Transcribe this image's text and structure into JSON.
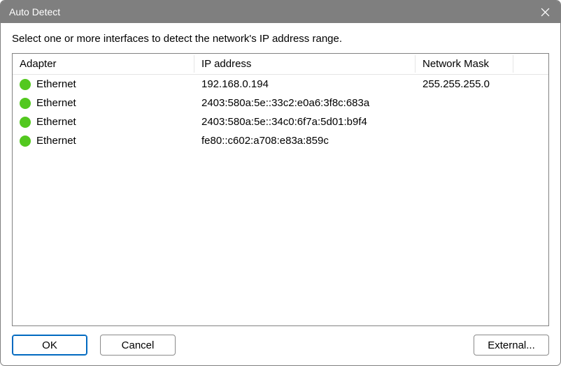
{
  "window": {
    "title": "Auto Detect"
  },
  "instruction": "Select one or more interfaces to detect the network's IP address range.",
  "columns": {
    "adapter": "Adapter",
    "ip": "IP address",
    "mask": "Network Mask"
  },
  "rows": [
    {
      "status": "up",
      "adapter": "Ethernet",
      "ip": "192.168.0.194",
      "mask": "255.255.255.0"
    },
    {
      "status": "up",
      "adapter": "Ethernet",
      "ip": "2403:580a:5e::33c2:e0a6:3f8c:683a",
      "mask": ""
    },
    {
      "status": "up",
      "adapter": "Ethernet",
      "ip": "2403:580a:5e::34c0:6f7a:5d01:b9f4",
      "mask": ""
    },
    {
      "status": "up",
      "adapter": "Ethernet",
      "ip": "fe80::c602:a708:e83a:859c",
      "mask": ""
    }
  ],
  "buttons": {
    "ok": "OK",
    "cancel": "Cancel",
    "external": "External..."
  },
  "colors": {
    "status_up": "#53c81f",
    "titlebar_bg": "#7f7f7f",
    "primary_border": "#0069c0"
  }
}
